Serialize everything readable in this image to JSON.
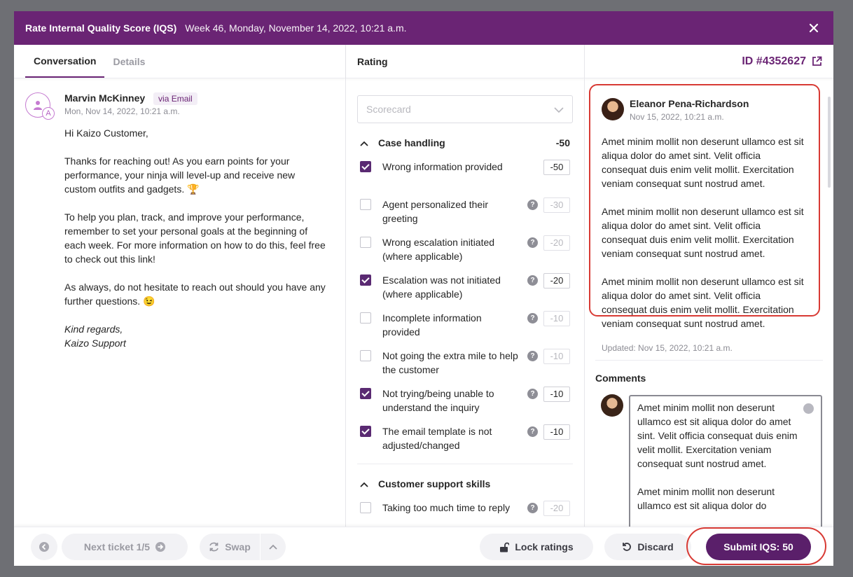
{
  "header": {
    "title": "Rate Internal Quality Score (IQS)",
    "subtitle": "Week 46, Monday, November 14, 2022, 10:21 a.m."
  },
  "left": {
    "tabs": [
      "Conversation",
      "Details"
    ],
    "message": {
      "author": "Marvin McKinney",
      "channel": "via Email",
      "badge": "A",
      "date": "Mon, Nov 14, 2022, 10:21 a.m.",
      "paragraphs": [
        "Hi Kaizo Customer,",
        "Thanks for reaching out! As you earn points for your performance, your ninja will level-up and receive new custom outfits and gadgets. 🏆",
        "To help you plan, track, and improve your performance, remember to set your personal goals at the beginning of each week. For more information on how to do this, feel free to check out this link!",
        "As always, do not hesitate to reach out should you have any further questions. 😉"
      ],
      "signoff_1": "Kind regards,",
      "signoff_2": "Kaizo Support"
    }
  },
  "middle": {
    "title": "Rating",
    "scorecard_placeholder": "Scorecard",
    "sections": [
      {
        "name": "Case handling",
        "score": "-50",
        "items": [
          {
            "label": "Wrong information provided",
            "points": "-50",
            "checked": true,
            "help": false
          },
          {
            "label": "Agent personalized their greeting",
            "points": "-30",
            "checked": false,
            "help": true
          },
          {
            "label": "Wrong escalation initiated (where applicable)",
            "points": "-20",
            "checked": false,
            "help": true
          },
          {
            "label": "Escalation was not initiated (where applicable)",
            "points": "-20",
            "checked": true,
            "help": true
          },
          {
            "label": "Incomplete information provided",
            "points": "-10",
            "checked": false,
            "help": true
          },
          {
            "label": "Not going the extra mile to help the customer",
            "points": "-10",
            "checked": false,
            "help": true
          },
          {
            "label": "Not trying/being unable to understand the inquiry",
            "points": "-10",
            "checked": true,
            "help": true
          },
          {
            "label": "The email template is not adjusted/changed",
            "points": "-10",
            "checked": true,
            "help": true
          }
        ]
      },
      {
        "name": "Customer support skills",
        "score": "",
        "items": [
          {
            "label": "Taking too much time to reply",
            "points": "-20",
            "checked": false,
            "help": true
          }
        ]
      }
    ]
  },
  "right": {
    "ticket_id": "ID #4352627",
    "note": {
      "author": "Eleanor Pena-Richardson",
      "date": "Nov 15, 2022, 10:21 a.m.",
      "paragraphs": [
        "Amet minim mollit non deserunt ullamco est sit aliqua dolor do amet sint. Velit officia consequat duis enim velit mollit. Exercitation veniam consequat sunt nostrud amet.",
        "Amet minim mollit non deserunt ullamco est sit aliqua dolor do amet sint. Velit officia consequat duis enim velit mollit. Exercitation veniam consequat sunt nostrud amet.",
        "Amet minim mollit non deserunt ullamco est sit aliqua dolor do amet sint. Velit officia consequat duis enim velit mollit. Exercitation veniam consequat sunt nostrud amet."
      ],
      "updated": "Updated: Nov 15, 2022, 10:21 a.m."
    },
    "comments_label": "Comments",
    "comment_paragraphs": [
      "Amet minim mollit non deserunt ullamco est sit aliqua dolor do amet sint. Velit officia consequat duis enim velit mollit. Exercitation veniam consequat sunt nostrud amet.",
      "Amet minim mollit non deserunt ullamco est sit aliqua dolor do"
    ]
  },
  "footer": {
    "next_ticket": "Next ticket 1/5",
    "swap": "Swap",
    "lock": "Lock ratings",
    "discard": "Discard",
    "submit": "Submit IQS: 50"
  },
  "colors": {
    "brand": "#6a2474",
    "submit": "#5a1f6a",
    "highlight": "#d83a34"
  }
}
